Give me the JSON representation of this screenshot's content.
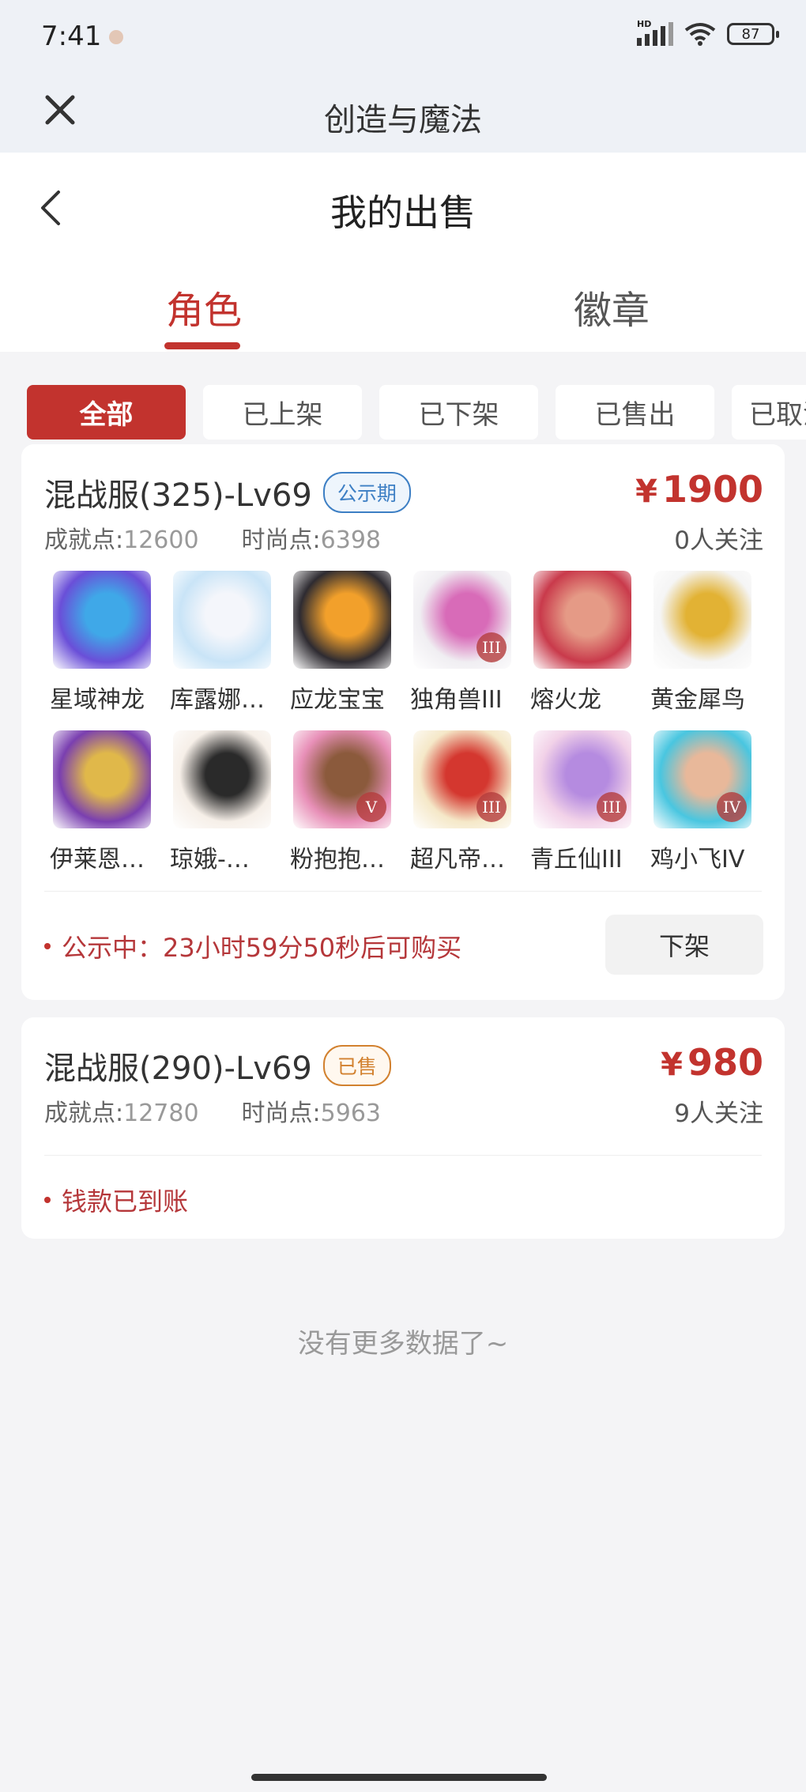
{
  "status_bar": {
    "time": "7:41",
    "battery": "87"
  },
  "app_header": {
    "title": "创造与魔法"
  },
  "page_header": {
    "title": "我的出售"
  },
  "tabs": [
    {
      "label": "角色",
      "active": true
    },
    {
      "label": "徽章",
      "active": false
    }
  ],
  "filters": [
    {
      "label": "全部",
      "active": true
    },
    {
      "label": "已上架"
    },
    {
      "label": "已下架"
    },
    {
      "label": "已售出"
    },
    {
      "label": "已取消"
    }
  ],
  "listings": [
    {
      "server": "混战服(325)-Lv69",
      "tag": "公示期",
      "price_symbol": "¥",
      "price": "1900",
      "achievement_label": "成就点:",
      "achievement": "12600",
      "fashion_label": "时尚点:",
      "fashion": "6398",
      "followers": "0人关注",
      "pets": [
        {
          "name": "星域神龙",
          "colors": [
            "#6a4fd8",
            "#3fa8e8"
          ]
        },
        {
          "name": "库露娜…",
          "colors": [
            "#c9e4f7",
            "#f4f6fb"
          ]
        },
        {
          "name": "应龙宝宝",
          "colors": [
            "#2e2b31",
            "#f2a02b"
          ]
        },
        {
          "name": "独角兽III",
          "colors": [
            "#f0eef2",
            "#d86bb8"
          ],
          "badge": "III"
        },
        {
          "name": "熔火龙",
          "colors": [
            "#c93a4b",
            "#e59a86"
          ]
        },
        {
          "name": "黄金犀鸟",
          "colors": [
            "#f5f5f5",
            "#e2b234"
          ]
        },
        {
          "name": "伊莱恩…",
          "colors": [
            "#7a3fb0",
            "#e0b84a"
          ]
        },
        {
          "name": "琼娥-…",
          "colors": [
            "#f6efe8",
            "#2a2a2a"
          ]
        },
        {
          "name": "粉抱抱…",
          "colors": [
            "#e890b8",
            "#8b5a3c"
          ],
          "badge": "V"
        },
        {
          "name": "超凡帝…",
          "colors": [
            "#f5e8c8",
            "#d4372f"
          ],
          "badge": "III"
        },
        {
          "name": "青丘仙III",
          "colors": [
            "#f2d2e8",
            "#b58be0"
          ],
          "badge": "III"
        },
        {
          "name": "鸡小飞IV",
          "colors": [
            "#49c6e0",
            "#e8b89a"
          ],
          "badge": "IV"
        }
      ],
      "status": "公示中：23小时59分50秒后可购买",
      "action": "下架"
    },
    {
      "server": "混战服(290)-Lv69",
      "tag": "已售",
      "price_symbol": "¥",
      "price": "980",
      "achievement_label": "成就点:",
      "achievement": "12780",
      "fashion_label": "时尚点:",
      "fashion": "5963",
      "followers": "9人关注",
      "status": "钱款已到账"
    }
  ],
  "footer": {
    "no_more": "没有更多数据了~"
  }
}
